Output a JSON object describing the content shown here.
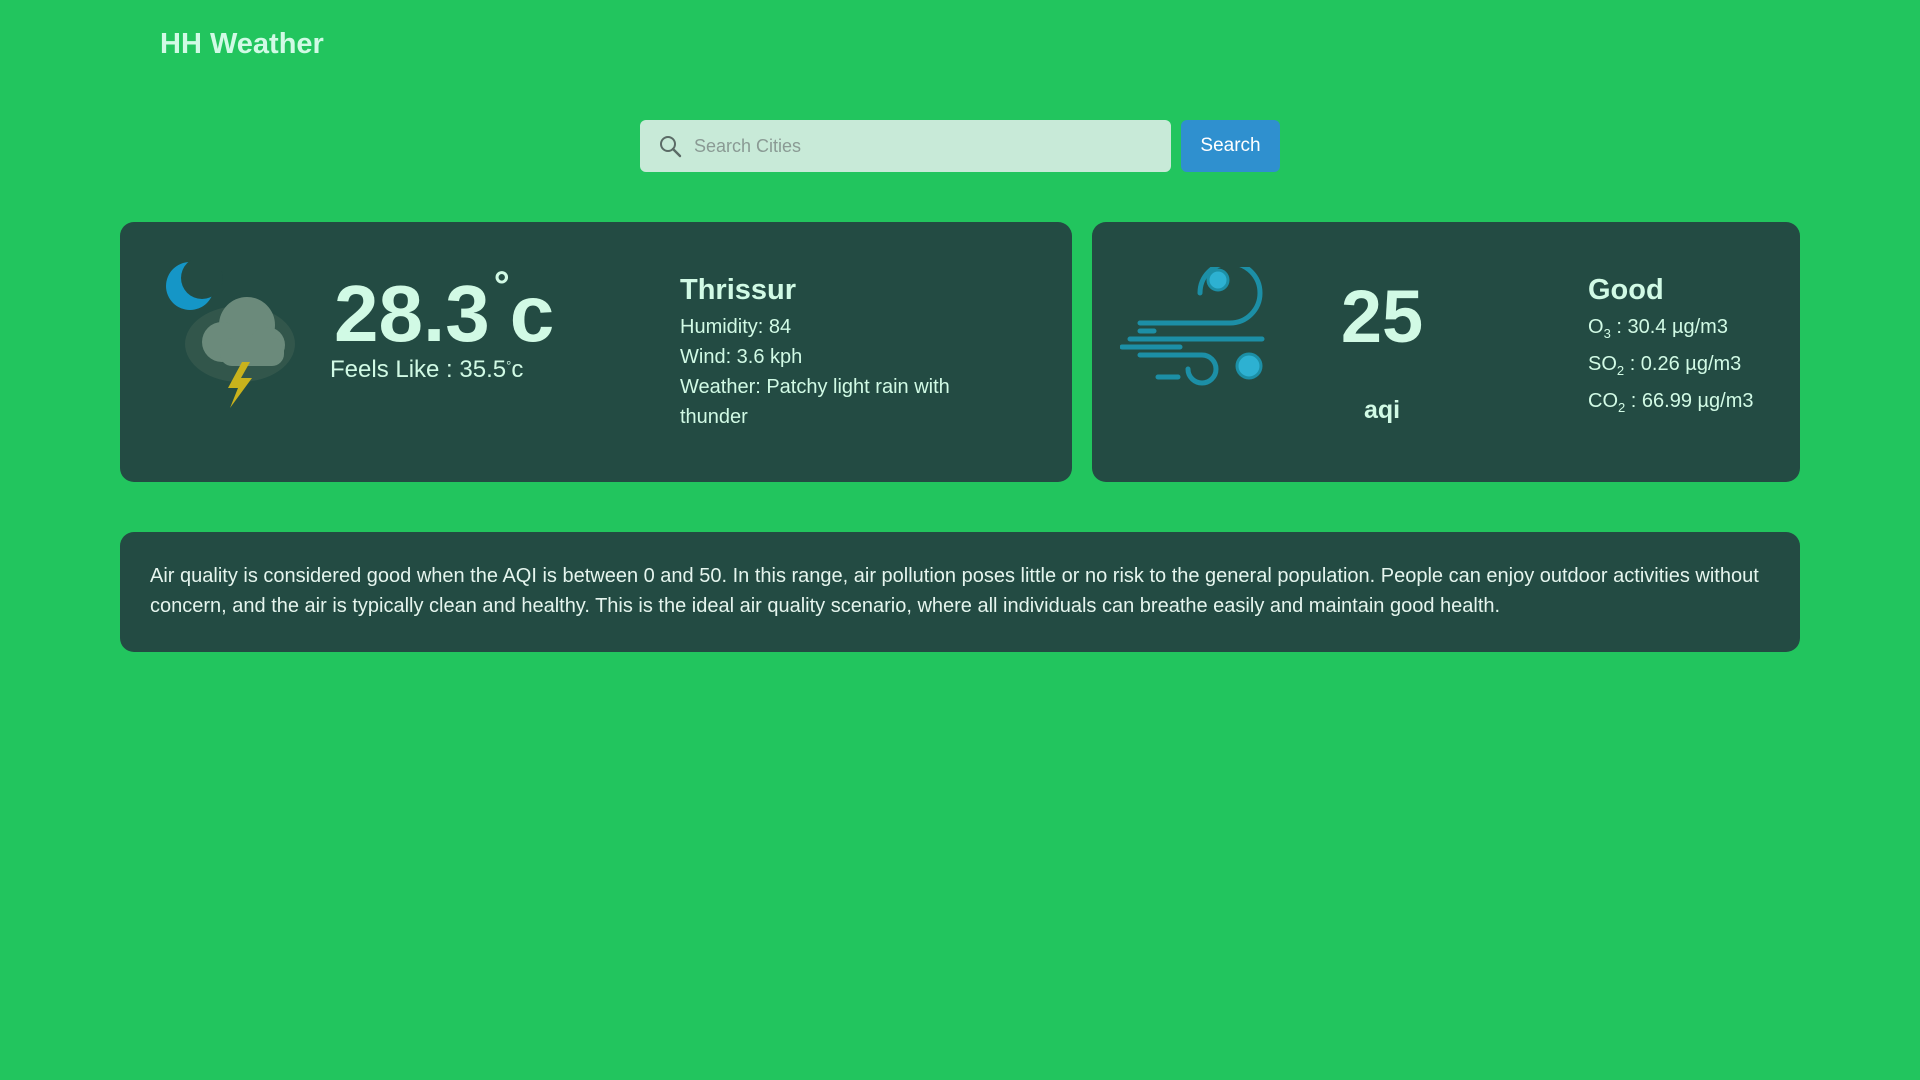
{
  "app": {
    "title": "HH Weather"
  },
  "search": {
    "placeholder": "Search Cities",
    "value": "",
    "button_label": "Search"
  },
  "weather": {
    "temperature": "28.3",
    "temperature_unit": "c",
    "degree_symbol": "°",
    "feels_like_label": "Feels Like : ",
    "feels_like_value": "35.5",
    "feels_like_unit": "c",
    "city": "Thrissur",
    "humidity": "Humidity: 84",
    "wind": "Wind: 3.6 kph",
    "condition": "Weather: Patchy light rain with thunder",
    "icon": "night-thunder-cloud-icon"
  },
  "air_quality": {
    "icon": "wind-icon",
    "aqi_value": "25",
    "aqi_label": "aqi",
    "status": "Good",
    "o3": {
      "prefix": "O",
      "sub": "3",
      "value": " : 30.4 µg/m3"
    },
    "so2": {
      "prefix": "SO",
      "sub": "2",
      "value": " : 0.26 µg/m3"
    },
    "co2": {
      "prefix": "CO",
      "sub": "2",
      "value": " : 66.99 µg/m3"
    }
  },
  "description": "Air quality is considered good when the AQI is between 0 and 50. In this range, air pollution poses little or no risk to the general population. People can enjoy outdoor activities without concern, and the air is typically clean and healthy. This is the ideal air quality scenario, where all individuals can breathe easily and maintain good health.",
  "colors": {
    "background": "#22c55e",
    "card": "#234b43",
    "text": "#d1fae5",
    "search_button": "#2f90cf",
    "search_box": "#c8ead8",
    "wind_icon": "#1c8fa6"
  }
}
